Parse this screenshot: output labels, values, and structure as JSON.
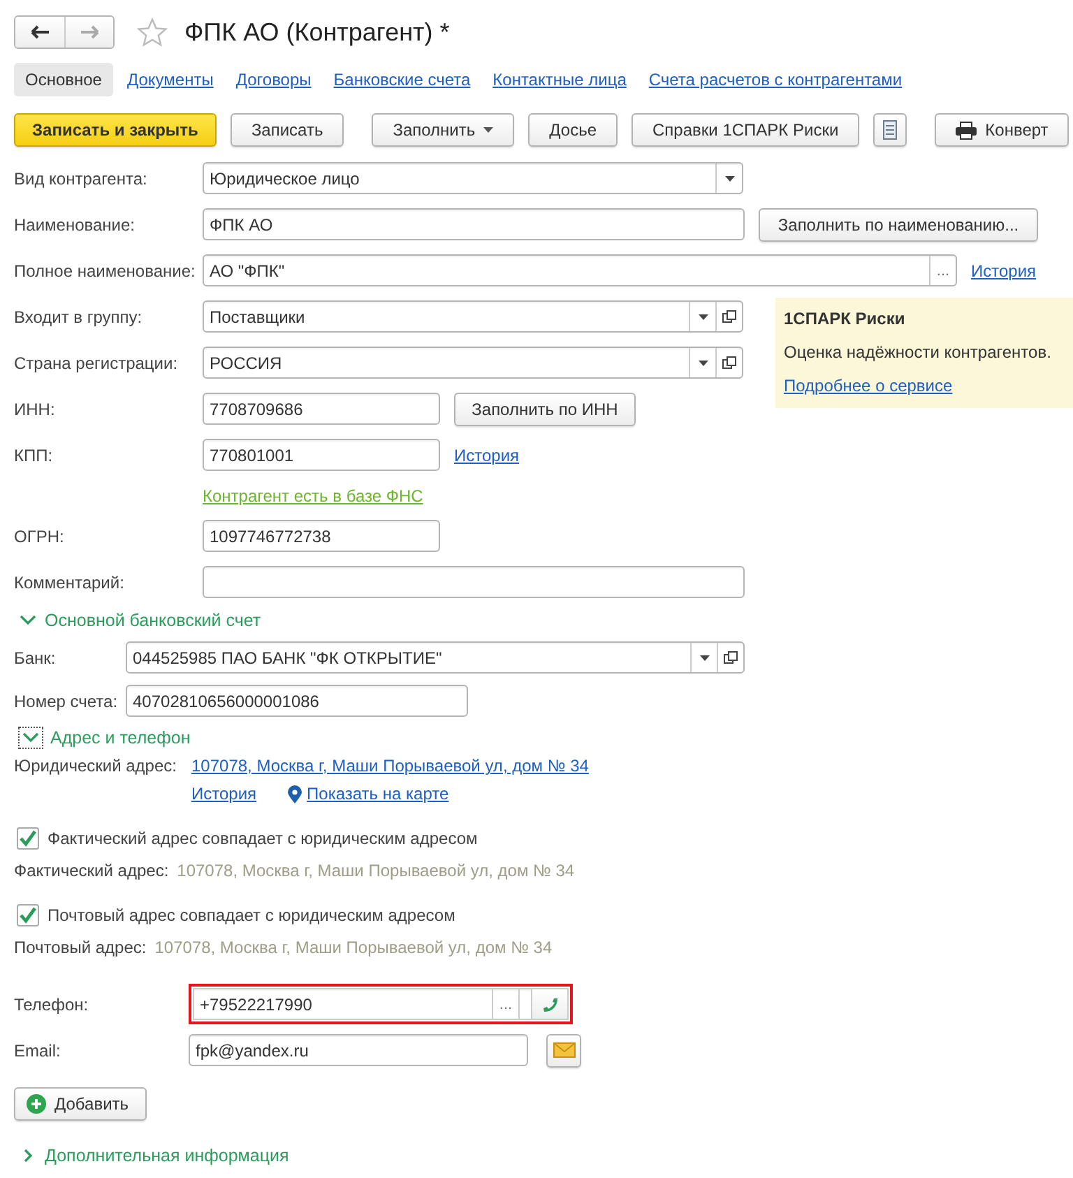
{
  "window": {
    "title": "ФПК АО (Контрагент) *",
    "favorite": false
  },
  "tabs": [
    {
      "label": "Основное",
      "selected": true
    },
    {
      "label": "Документы",
      "selected": false
    },
    {
      "label": "Договоры",
      "selected": false
    },
    {
      "label": "Банковские счета",
      "selected": false
    },
    {
      "label": "Контактные лица",
      "selected": false
    },
    {
      "label": "Счета расчетов с контрагентами",
      "selected": false
    }
  ],
  "toolbar": [
    {
      "kind": "primary",
      "label": "Записать и закрыть"
    },
    {
      "kind": "button",
      "label": "Записать"
    },
    {
      "kind": "menu",
      "label": "Заполнить"
    },
    {
      "kind": "button",
      "label": "Досье"
    },
    {
      "kind": "button",
      "label": "Справки 1СПАРК Риски"
    },
    {
      "kind": "report"
    },
    {
      "kind": "print",
      "label": "Конверт"
    }
  ],
  "counterparty_type": {
    "label": "Вид контрагента:",
    "value": "Юридическое лицо"
  },
  "name": {
    "label": "Наименование:",
    "value": "ФПК АО",
    "button": "Заполнить по наименованию..."
  },
  "full_name": {
    "label": "Полное наименование:",
    "value": "АО \"ФПК\"",
    "button": "...",
    "link": "История"
  },
  "group": {
    "label": "Входит в группу:",
    "value": "Поставщики"
  },
  "country": {
    "label": "Страна регистрации:",
    "value": "РОССИЯ"
  },
  "inn": {
    "label": "ИНН:",
    "value": "7708709686",
    "button": "Заполнить по ИНН"
  },
  "kpp": {
    "label": "КПП:",
    "value": "770801001",
    "link": "История"
  },
  "fns_status": "Контрагент есть в базе ФНС",
  "ogrn": {
    "label": "ОГРН:",
    "value": "1097746772738"
  },
  "comment": {
    "label": "Комментарий:"
  },
  "spark_panel": {
    "title": "1СПАРК Риски",
    "text": "Оценка надёжности контрагентов.",
    "link": "Подробнее о сервисе"
  },
  "bank_section": {
    "title": "Основной банковский счет",
    "expanded": true,
    "bank": {
      "label": "Банк:",
      "value": "044525985 ПАО БАНК \"ФК ОТКРЫТИЕ\""
    },
    "account": {
      "label": "Номер счета:",
      "value": "40702810656000001086"
    }
  },
  "address_section": {
    "title": "Адрес и телефон",
    "expanded": true,
    "legal_address": {
      "label": "Юридический адрес:",
      "value": "107078, Москва г, Маши Порываевой ул, дом № 34",
      "history_link": "История",
      "map_link": "Показать на карте"
    },
    "actual": {
      "checkbox_label": "Фактический адрес совпадает с юридическим адресом",
      "checked": true,
      "label": "Фактический адрес:",
      "value": "107078, Москва г, Маши Порываевой ул, дом № 34"
    },
    "postal": {
      "checkbox_label": "Почтовый адрес совпадает с юридическим адресом",
      "checked": true,
      "label": "Почтовый адрес:",
      "value": "107078, Москва г, Маши Порываевой ул, дом № 34"
    },
    "phone": {
      "label": "Телефон:",
      "value": "+79522217990",
      "button": "...",
      "highlighted": true
    },
    "email": {
      "label": "Email:",
      "value": "fpk@yandex.ru"
    }
  },
  "add_button": "Добавить",
  "extra_section": {
    "title": "Дополнительная информация",
    "expanded": false
  }
}
